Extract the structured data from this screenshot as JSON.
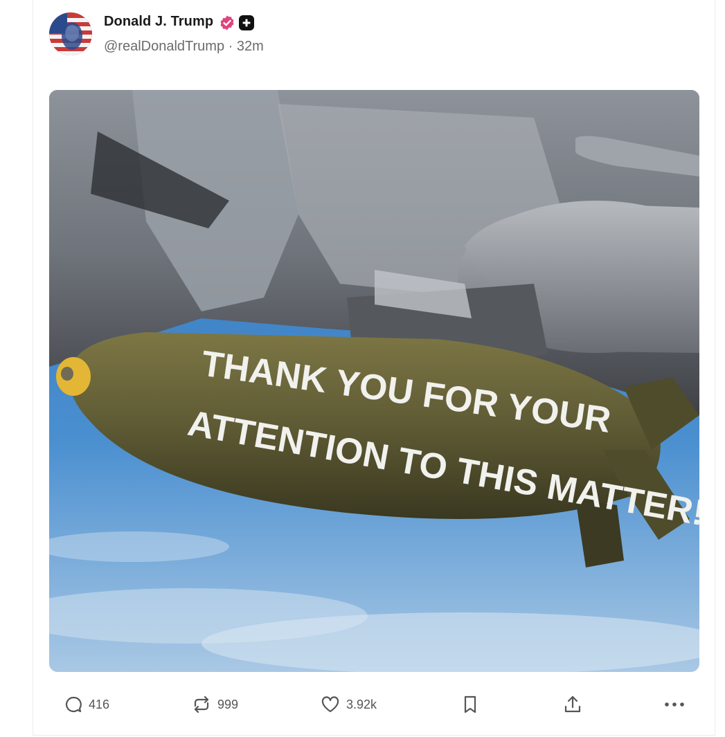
{
  "post": {
    "author_name": "Donald J. Trump",
    "handle": "@realDonaldTrump",
    "separator": "·",
    "time": "32m",
    "badges": [
      "verified-badge-icon",
      "plus-badge-icon"
    ],
    "image": {
      "alt_text_lines": [
        "THANK YOU FOR YOUR",
        "ATTENTION TO THIS MATTER!"
      ],
      "colors": {
        "sky": "#3f86c9",
        "bomb": "#5e5a34",
        "jet": "#7c8188"
      }
    }
  },
  "actions": {
    "replies": "416",
    "reposts": "999",
    "likes": "3.92k",
    "icons": [
      "reply-icon",
      "repost-icon",
      "like-icon",
      "bookmark-icon",
      "share-icon",
      "more-icon"
    ]
  },
  "colors": {
    "accent_pink": "#e0427e",
    "text": "#1a1a1a",
    "muted": "#6b6b6b"
  }
}
